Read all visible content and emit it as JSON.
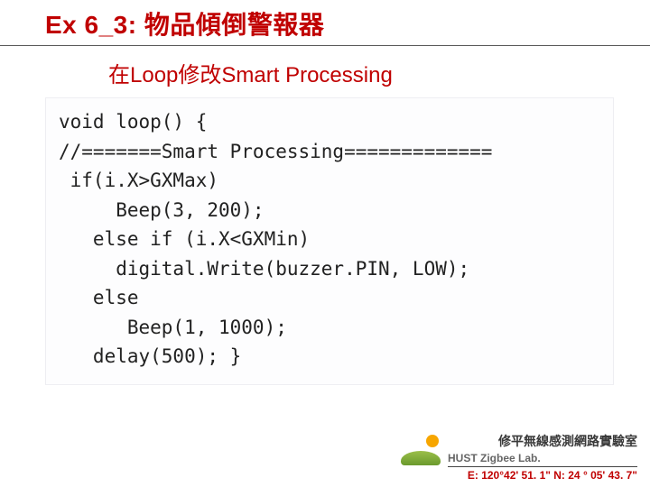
{
  "header": {
    "title": "Ex 6_3: 物品傾倒警報器",
    "subtitle": "在Loop修改Smart Processing"
  },
  "code": {
    "lines": [
      "void loop() {",
      "//=======Smart Processing=============",
      " if(i.X>GXMax)",
      "     Beep(3, 200);",
      "   else if (i.X<GXMin)",
      "     digital.Write(buzzer.PIN, LOW);",
      "   else",
      "      Beep(1, 1000);",
      "   delay(500); }"
    ]
  },
  "footer": {
    "lab_cn": "修平無線感測網路實驗室",
    "lab_en": "HUST Zigbee Lab.",
    "coords": "E: 120°42' 51. 1\"  N: 24 ° 05' 43. 7\""
  }
}
